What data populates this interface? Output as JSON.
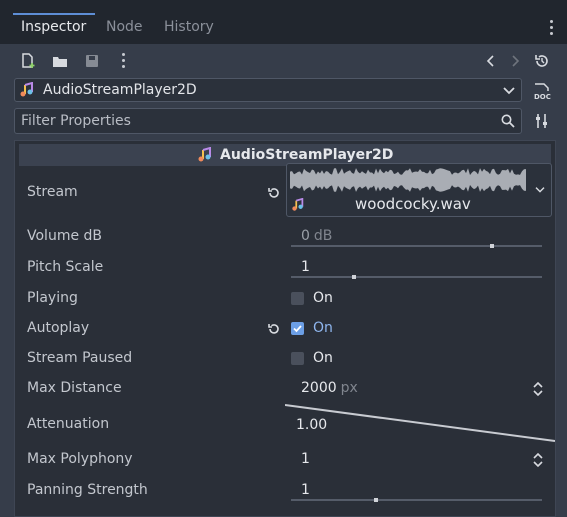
{
  "tabs": [
    {
      "label": "Inspector",
      "active": true
    },
    {
      "label": "Node",
      "active": false
    },
    {
      "label": "History",
      "active": false
    }
  ],
  "selector": {
    "label": "AudioStreamPlayer2D"
  },
  "filter": {
    "placeholder": "Filter Properties"
  },
  "section": {
    "title": "AudioStreamPlayer2D"
  },
  "properties": {
    "stream": {
      "label": "Stream",
      "file": "woodcocky.wav"
    },
    "volume": {
      "label": "Volume dB",
      "value": "0",
      "unit": "dB",
      "fraction": 0.8
    },
    "pitch": {
      "label": "Pitch Scale",
      "value": "1",
      "fraction": 0.25
    },
    "playing": {
      "label": "Playing",
      "state": "On",
      "checked": false
    },
    "autoplay": {
      "label": "Autoplay",
      "state": "On",
      "checked": true
    },
    "paused": {
      "label": "Stream Paused",
      "state": "On",
      "checked": false
    },
    "maxdist": {
      "label": "Max Distance",
      "value": "2000",
      "unit": "px"
    },
    "atten": {
      "label": "Attenuation",
      "value": "1.00"
    },
    "poly": {
      "label": "Max Polyphony",
      "value": "1"
    },
    "panning": {
      "label": "Panning Strength",
      "value": "1",
      "fraction": 0.34
    }
  },
  "colors": {
    "accent": "#6c9fe6",
    "background": "#363d4a",
    "panel": "#2a2f38"
  },
  "icons": [
    "new-resource-icon",
    "open-folder-icon",
    "save-icon",
    "more-icon",
    "back-arrow-icon",
    "forward-arrow-icon",
    "history-icon",
    "audio-stream-icon",
    "chevron-down-icon",
    "help-icon",
    "search-icon",
    "property-settings-icon",
    "reset-icon",
    "stepper-icon"
  ]
}
